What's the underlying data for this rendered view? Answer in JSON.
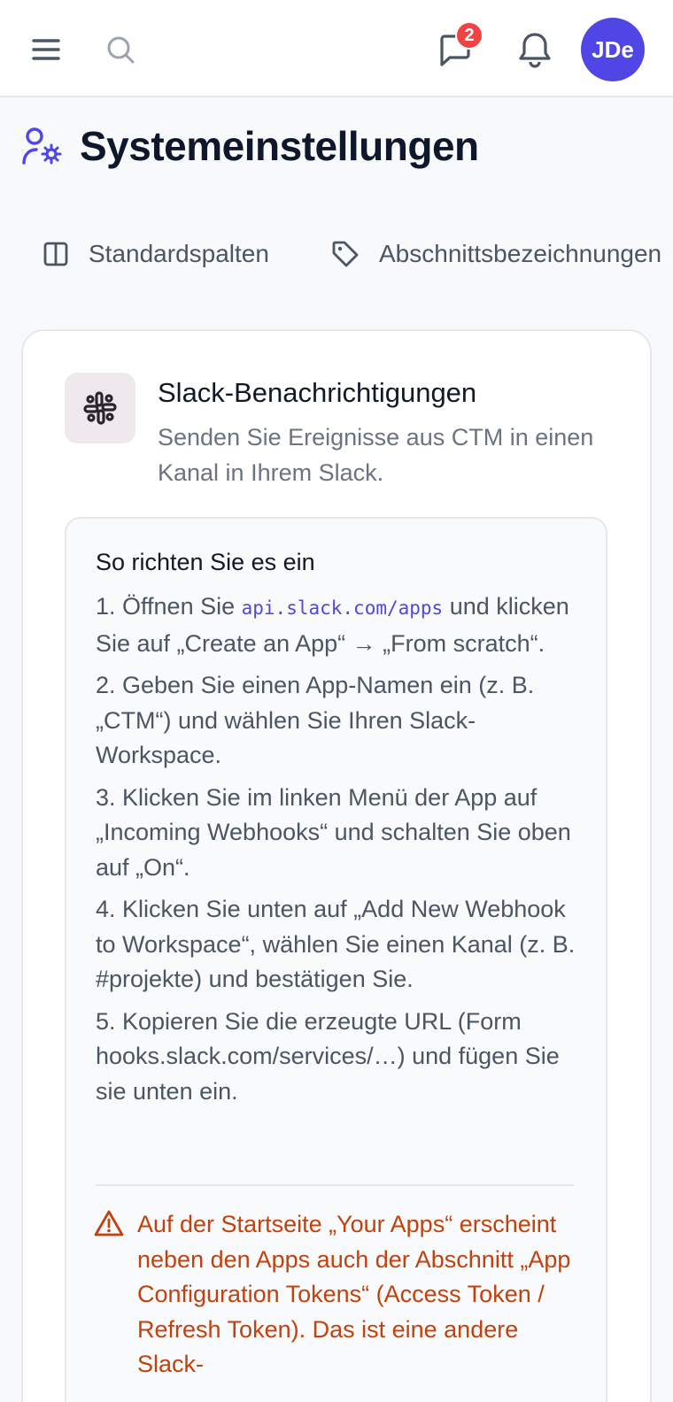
{
  "header": {
    "notification_count": "2",
    "avatar_initials": "JDe",
    "accent_color": "#4f46e5",
    "icons": [
      "menu-icon",
      "search-icon",
      "chat-icon",
      "bell-icon"
    ]
  },
  "page": {
    "title": "Systemeinstellungen",
    "title_icon": "user-settings-icon"
  },
  "tabs": [
    {
      "label": "Standardspalten",
      "icon": "columns-icon"
    },
    {
      "label": "Abschnittsbezeichnungen",
      "icon": "tag-icon"
    }
  ],
  "slack_card": {
    "title": "Slack-Benachrichtigungen",
    "description": "Senden Sie Ereignisse aus CTM in einen Kanal in Ihrem Slack.",
    "howto": {
      "title": "So richten Sie es ein",
      "step1_prefix": "1. Öffnen Sie ",
      "step1_link": "api.slack.com/apps",
      "step1_suffix": " und klicken Sie auf „Create an App“ → „From scratch“.",
      "step2": "2. Geben Sie einen App-Namen ein (z. B. „CTM“) und wählen Sie Ihren Slack-Workspace.",
      "step3": "3. Klicken Sie im linken Menü der App auf „Incoming Webhooks“ und schalten Sie oben auf „On“.",
      "step4": "4. Klicken Sie unten auf „Add New Webhook to Workspace“, wählen Sie einen Kanal (z. B. #projekte) und bestätigen Sie.",
      "step5": "5. Kopieren Sie die erzeugte URL (Form hooks.slack.com/services/…) und fügen Sie sie unten ein.",
      "warning": "Auf der Startseite „Your Apps“ erscheint neben den Apps auch der Abschnitt „App Configuration Tokens“ (Access Token / Refresh Token). Das ist eine andere Slack-",
      "warning_color": "#c2410c"
    }
  }
}
